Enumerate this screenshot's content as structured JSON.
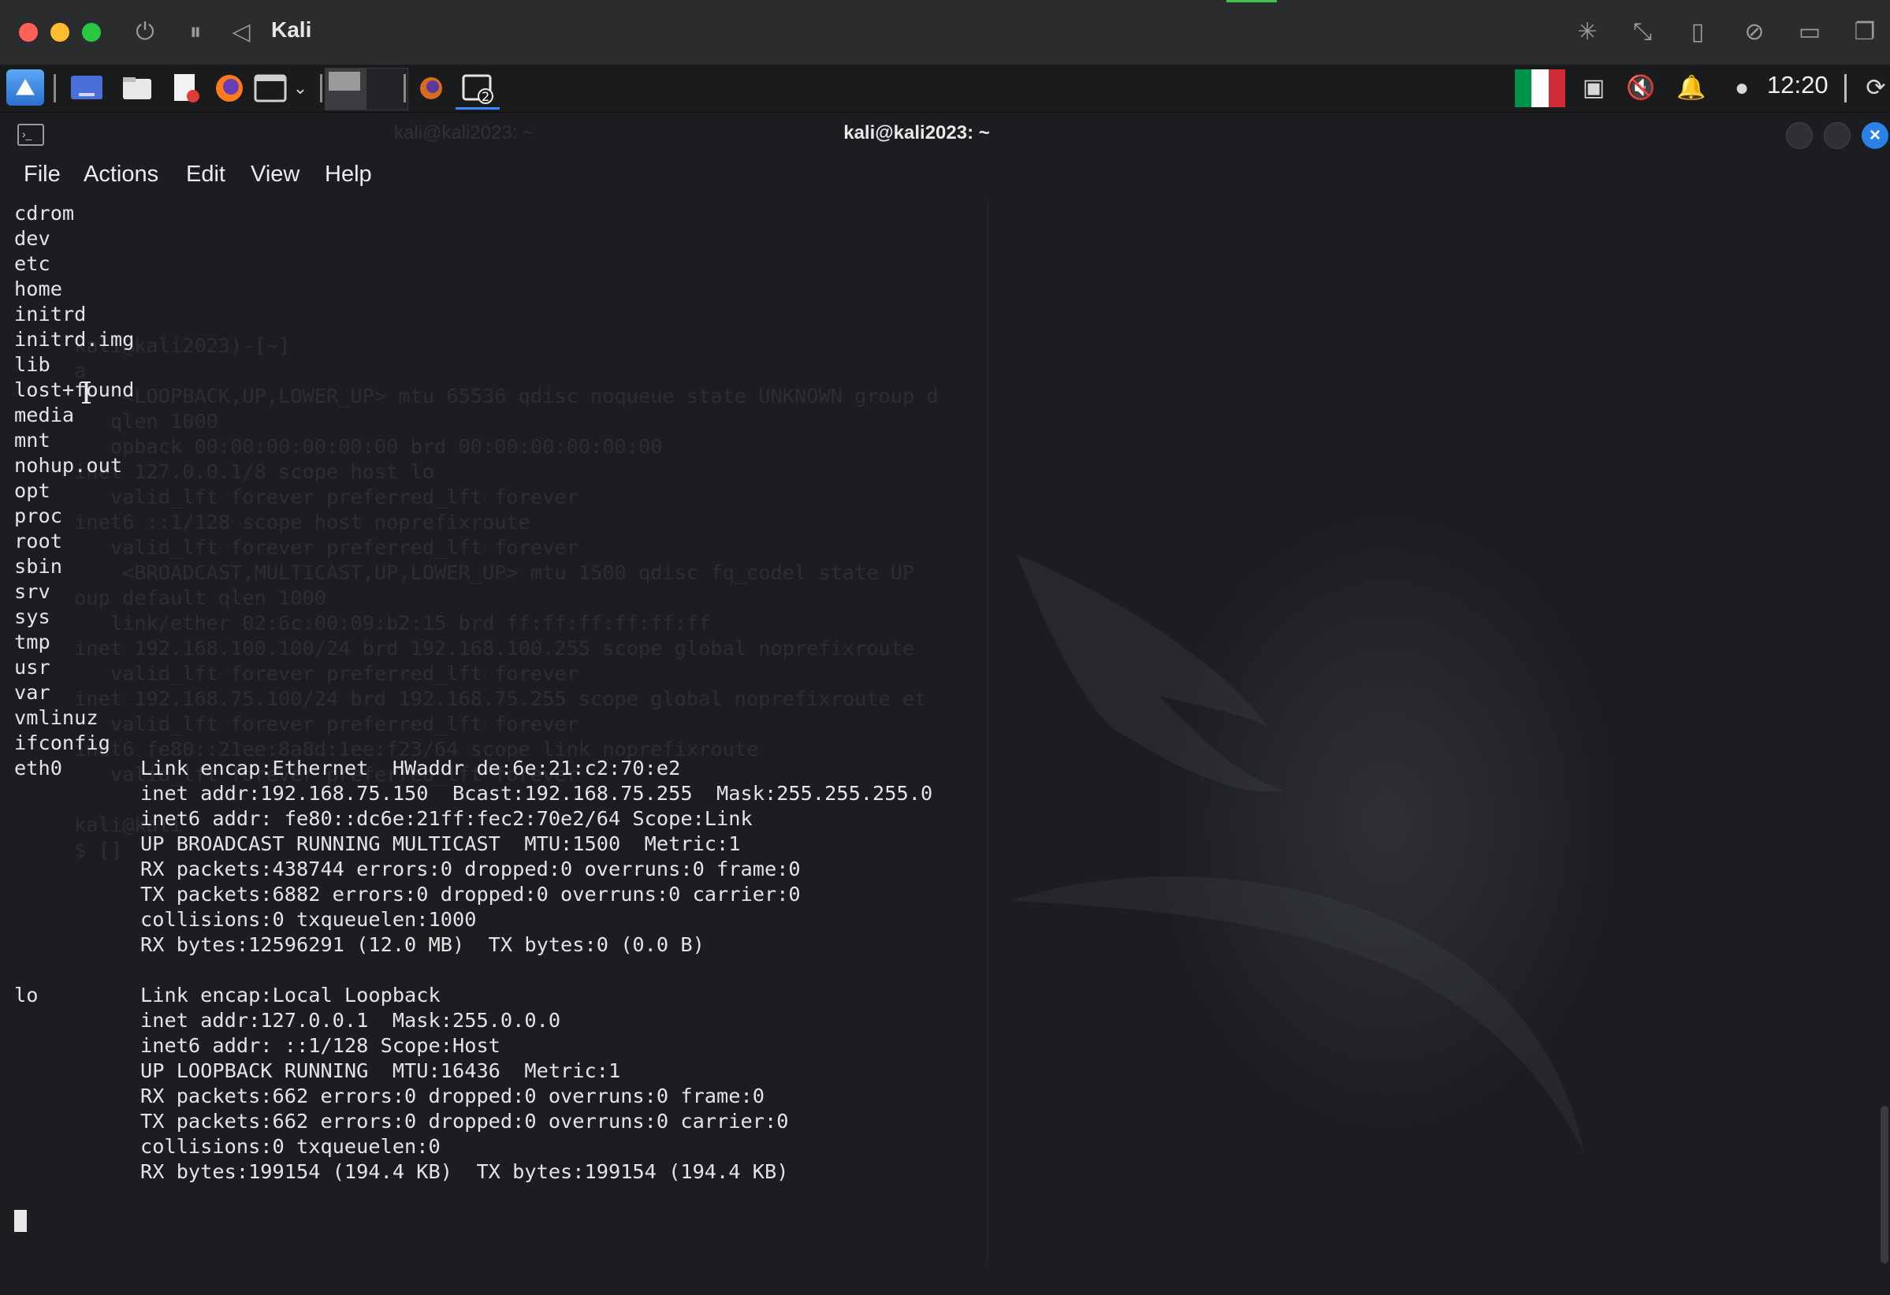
{
  "mac": {
    "vm_title": "Kali"
  },
  "panel": {
    "clock": "12:20",
    "workspace_badge": "2",
    "flag_colors": [
      "#009246",
      "#ffffff",
      "#ce2b37"
    ]
  },
  "terminal": {
    "title": "kali@kali2023: ~",
    "ghost_tab_title": "kali@kali2023: ~",
    "menu": [
      "File",
      "Actions",
      "Edit",
      "View",
      "Help"
    ],
    "dir_listing": [
      "cdrom",
      "dev",
      "etc",
      "home",
      "initrd",
      "initrd.img",
      "lib",
      "lost+found",
      "media",
      "mnt",
      "nohup.out",
      "opt",
      "proc",
      "root",
      "sbin",
      "srv",
      "sys",
      "tmp",
      "usr",
      "var",
      "vmlinuz",
      "ifconfig"
    ],
    "interfaces": [
      {
        "name": "eth0",
        "lines": [
          "Link encap:Ethernet  HWaddr de:6e:21:c2:70:e2",
          "inet addr:192.168.75.150  Bcast:192.168.75.255  Mask:255.255.255.0",
          "inet6 addr: fe80::dc6e:21ff:fec2:70e2/64 Scope:Link",
          "UP BROADCAST RUNNING MULTICAST  MTU:1500  Metric:1",
          "RX packets:438744 errors:0 dropped:0 overruns:0 frame:0",
          "TX packets:6882 errors:0 dropped:0 overruns:0 carrier:0",
          "collisions:0 txqueuelen:1000",
          "RX bytes:12596291 (12.0 MB)  TX bytes:0 (0.0 B)"
        ]
      },
      {
        "name": "lo",
        "lines": [
          "Link encap:Local Loopback",
          "inet addr:127.0.0.1  Mask:255.0.0.0",
          "inet6 addr: ::1/128 Scope:Host",
          "UP LOOPBACK RUNNING  MTU:16436  Metric:1",
          "RX packets:662 errors:0 dropped:0 overruns:0 frame:0",
          "TX packets:662 errors:0 dropped:0 overruns:0 carrier:0",
          "collisions:0 txqueuelen:0",
          "RX bytes:199154 (194.4 KB)  TX bytes:199154 (194.4 KB)"
        ]
      }
    ],
    "ghost_lines": [
      "     kali@kali2023)-[~]",
      "     a",
      "         <LOOPBACK,UP,LOWER_UP> mtu 65536 qdisc noqueue state UNKNOWN group d",
      "        qlen 1000",
      "        opback 00:00:00:00:00:00 brd 00:00:00:00:00:00",
      "     inet 127.0.0.1/8 scope host lo",
      "        valid_lft forever preferred_lft forever",
      "     inet6 ::1/128 scope host noprefixroute",
      "        valid_lft forever preferred_lft forever",
      "         <BROADCAST,MULTICAST,UP,LOWER_UP> mtu 1500 qdisc fq_codel state UP",
      "     oup default qlen 1000",
      "        link/ether 02:6c:00:09:b2:15 brd ff:ff:ff:ff:ff:ff",
      "     inet 192.168.100.100/24 brd 192.168.100.255 scope global noprefixroute",
      "        valid_lft forever preferred_lft forever",
      "     inet 192.168.75.100/24 brd 192.168.75.255 scope global noprefixroute et",
      "        valid_lft forever preferred_lft forever",
      "     inet6 fe80::21ee:8a8d:1ee:f23/64 scope link noprefixroute",
      "        valid_lft forever preferred_lft forever",
      "",
      "     kali@kali",
      "     $ []"
    ]
  }
}
